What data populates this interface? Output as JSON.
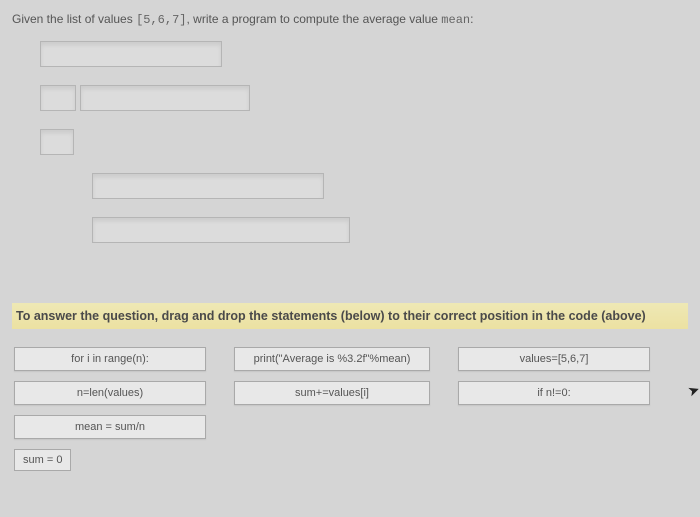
{
  "question": {
    "prefix": "Given the list of values ",
    "code_snippet": "[5,6,7]",
    "middle": ", write a program to compute the average value ",
    "code_var": "mean",
    "suffix": ":"
  },
  "instruction": "To answer the question, drag and drop the statements (below) to their correct position in the code (above)",
  "source_items": {
    "row1": {
      "col1": "for i in range(n):",
      "col2": "print(\"Average is %3.2f\"%mean)",
      "col3": "values=[5,6,7]"
    },
    "row2": {
      "col1": "n=len(values)",
      "col2": "sum+=values[i]",
      "col3": "if n!=0:"
    },
    "row3": {
      "col1": "mean = sum/n"
    },
    "row4": {
      "item": "sum = 0"
    }
  }
}
